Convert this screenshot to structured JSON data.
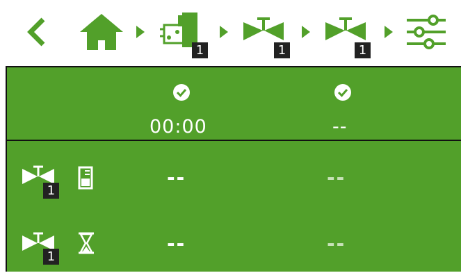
{
  "nav": {
    "back_icon": "chevron-left-icon",
    "items": [
      {
        "icon": "home-icon"
      },
      {
        "icon": "controller-icon",
        "badge": "1"
      },
      {
        "icon": "valve-icon",
        "badge": "1"
      },
      {
        "icon": "valve-icon",
        "badge": "1"
      }
    ],
    "settings_icon": "sliders-icon"
  },
  "table": {
    "columns": [
      {
        "icon": "check-circle-icon",
        "value": "00:00"
      },
      {
        "icon": "check-circle-icon",
        "value": "--"
      }
    ],
    "rows": [
      {
        "valve_badge": "1",
        "icon": "tank-level-icon",
        "values": [
          "--",
          "--"
        ]
      },
      {
        "valve_badge": "1",
        "icon": "hourglass-icon",
        "values": [
          "--",
          "--"
        ]
      }
    ]
  },
  "colors": {
    "accent": "#52a02a",
    "text_light": "#ffffff",
    "text_dim": "#c8e2b8",
    "badge": "#222222"
  }
}
